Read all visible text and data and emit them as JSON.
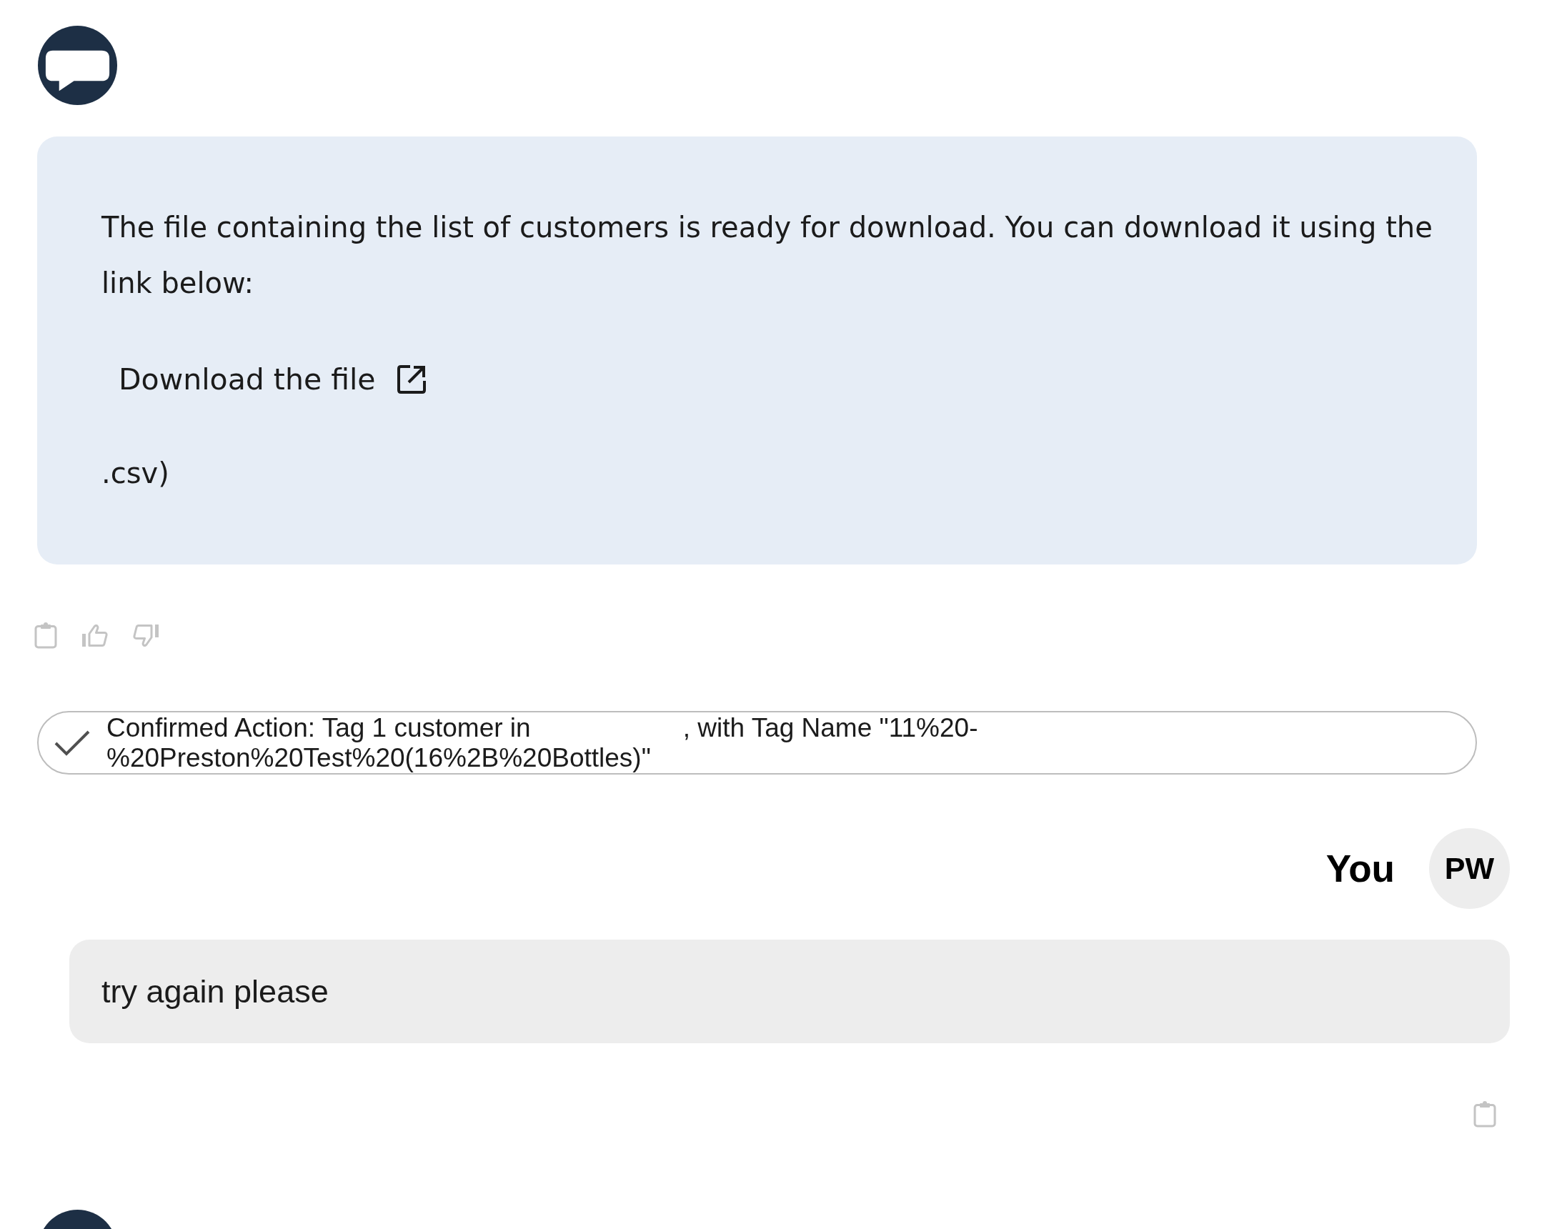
{
  "messages": [
    {
      "kind": "assistant",
      "blocks": [
        {
          "kind": "text",
          "text": "The file containing the list of customers is ready for download. You can download it using the link below:"
        },
        {
          "kind": "link",
          "text": "Download the file"
        },
        {
          "kind": "text",
          "text": ".csv)"
        }
      ]
    },
    {
      "kind": "action",
      "text_before": "Confirmed Action: Tag 1 customer in",
      "text_after": ", with Tag Name \"11%20-%20Preston%20Test%20(16%2B%20Bottles)\""
    },
    {
      "kind": "user",
      "sender": "You",
      "initials": "PW",
      "text": "try again please"
    },
    {
      "kind": "assistant"
    }
  ]
}
